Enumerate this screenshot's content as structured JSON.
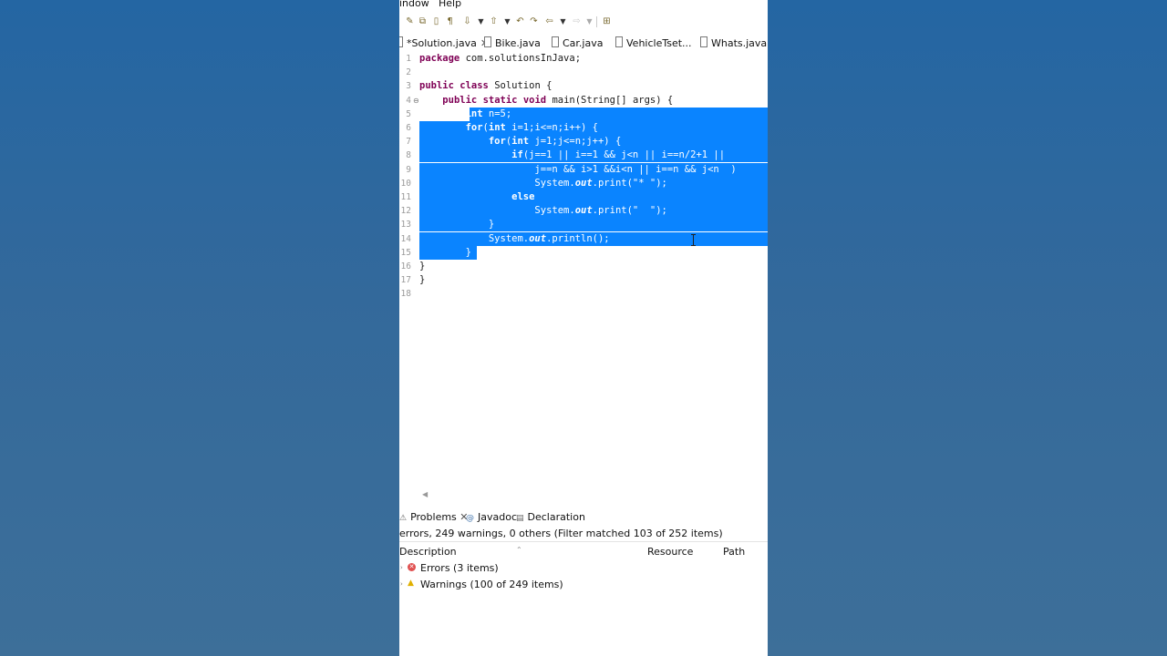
{
  "menu": [
    "indow",
    "Help"
  ],
  "toolbar_icons": [
    "pin-icon",
    "toggle-block-icon",
    "toggle-mark-icon",
    "pilcrow-icon",
    "next-annotation-icon",
    "dropdown-arrow",
    "prev-annotation-icon",
    "dropdown-arrow",
    "last-edit-icon",
    "edit-location-icon",
    "back-icon",
    "dropdown-arrow",
    "forward-icon",
    "dropdown-arrow",
    "open-console-icon"
  ],
  "tabs": [
    {
      "label": "*Solution.java",
      "active": true,
      "close": "✕"
    },
    {
      "label": "Bike.java"
    },
    {
      "label": "Car.java"
    },
    {
      "label": "VehicleTset..."
    },
    {
      "label": "Whats.java"
    }
  ],
  "editor": {
    "lines": [
      {
        "n": "1",
        "code": "package com.solutionsInJava;"
      },
      {
        "n": "2",
        "code": ""
      },
      {
        "n": "3",
        "code": "public class Solution {"
      },
      {
        "n": "4",
        "code": "    public static void main(String[] args) {"
      },
      {
        "n": "5",
        "code": "        int n=5;"
      },
      {
        "n": "6",
        "code": "        for(int i=1;i<=n;i++) {"
      },
      {
        "n": "7",
        "code": "            for(int j=1;j<=n;j++) {"
      },
      {
        "n": "8",
        "code": "                if(j==1 || i==1 && j<n || i==n/2+1 ||"
      },
      {
        "n": "9",
        "code": "                    j==n && i>1 &&i<n || i==n && j<n  )"
      },
      {
        "n": "10",
        "code": "                    System.out.print(\"* \");"
      },
      {
        "n": "11",
        "code": "                else"
      },
      {
        "n": "12",
        "code": "                    System.out.print(\"  \");"
      },
      {
        "n": "13",
        "code": "            }"
      },
      {
        "n": "14",
        "code": "            System.out.println();"
      },
      {
        "n": "15",
        "code": "        }"
      },
      {
        "n": "16",
        "code": "}"
      },
      {
        "n": "17",
        "code": "}"
      },
      {
        "n": "18",
        "code": ""
      }
    ]
  },
  "panel": {
    "tabs": [
      "Problems",
      "Javadoc",
      "Declaration"
    ],
    "problems_close": "✕",
    "summary": "errors, 249 warnings, 0 others (Filter matched 103 of 252 items)",
    "columns": {
      "description": "Description",
      "resource": "Resource",
      "path": "Path"
    },
    "rows": [
      {
        "label": "Errors (3 items)",
        "kind": "error"
      },
      {
        "label": "Warnings (100 of 249 items)",
        "kind": "warning"
      }
    ]
  },
  "colors": {
    "selection": "#0a84ff",
    "keyword": "#7f0055",
    "string": "#2a00ff",
    "background_left": "#2466a3"
  }
}
